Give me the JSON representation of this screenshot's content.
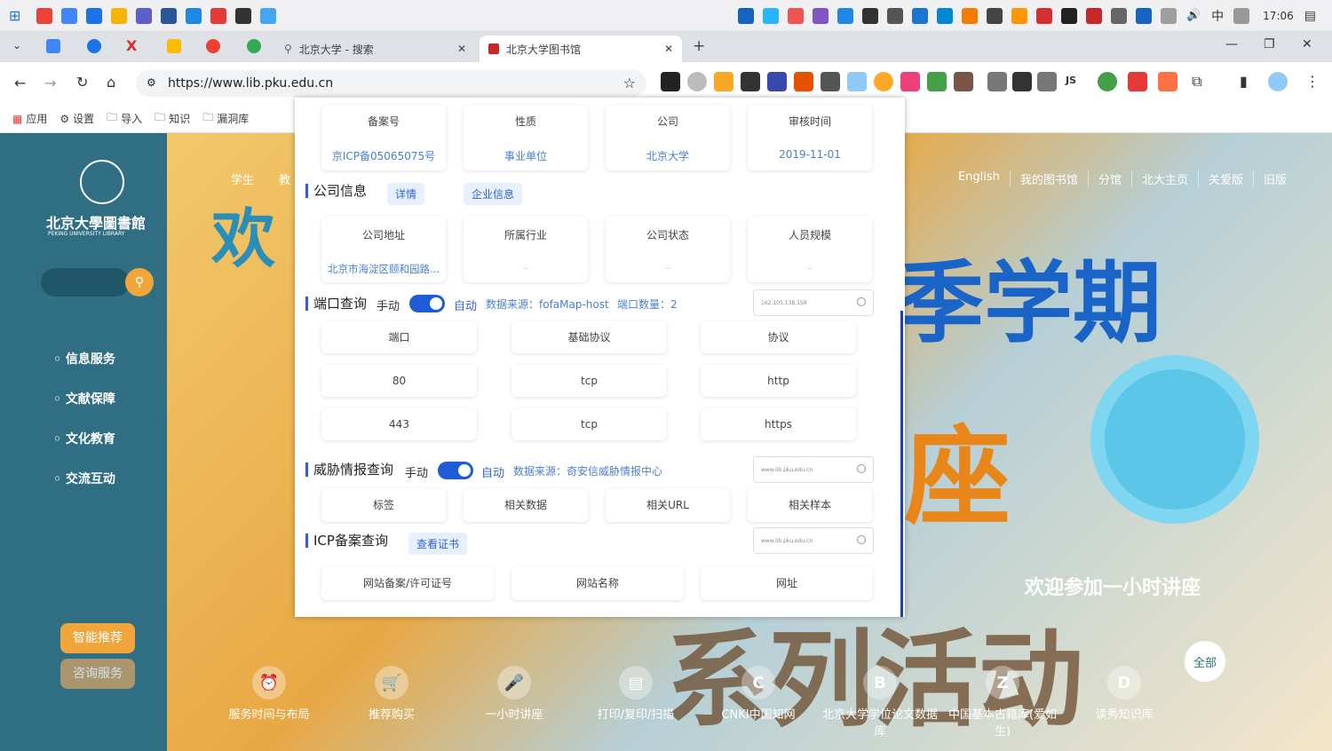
{
  "taskbar": {
    "clock": "17:06",
    "ime": "中"
  },
  "tabs": [
    {
      "label": "北京大学 - 搜索"
    },
    {
      "label": "北京大学图书馆"
    }
  ],
  "omnibox": {
    "url": "https://www.lib.pku.edu.cn"
  },
  "bookmarks": [
    "应用",
    "设置",
    "导入",
    "知识",
    "漏洞库"
  ],
  "site": {
    "logo_text": "北京大學圖書館",
    "logo_sub": "PEKING UNIVERSITY LIBRARY",
    "menu": [
      "信息服务",
      "文献保障",
      "文化教育",
      "交流互动"
    ],
    "nav": [
      "English",
      "我的图书馆",
      "分馆",
      "北大主页",
      "关爱版",
      "旧版"
    ],
    "nav_left": [
      "学生",
      "教"
    ],
    "hero_text": "欢迎参加一小时讲座",
    "hero_big": "季学期",
    "hero_big2": "系列活动",
    "hero_zuo": "座",
    "side_btns": [
      "智能推荐",
      "咨询服务"
    ],
    "all_btn": "全部",
    "shortcuts": [
      {
        "icon": "bell-icon",
        "label": "服务时间与布局"
      },
      {
        "icon": "cart-icon",
        "label": "推荐购买"
      },
      {
        "icon": "mic-icon",
        "label": "一小时讲座"
      },
      {
        "icon": "print-icon",
        "label": "打印/复印/扫描"
      },
      {
        "icon": "C",
        "label": "CNKI中国知网"
      },
      {
        "icon": "B",
        "label": "北京大学学位论文数据库"
      },
      {
        "icon": "Z",
        "label": "中国基本古籍库(爱如生)"
      },
      {
        "icon": "D",
        "label": "读秀知识库"
      }
    ]
  },
  "panel": {
    "icp_headers": [
      "备案号",
      "性质",
      "公司",
      "审核时间"
    ],
    "icp_values": [
      "京ICP备05065075号",
      "事业单位",
      "北京大学",
      "2019-11-01"
    ],
    "company_title": "公司信息",
    "company_tags": [
      "详情",
      "企业信息"
    ],
    "company_headers": [
      "公司地址",
      "所属行业",
      "公司状态",
      "人员规模"
    ],
    "company_values": [
      "北京市海淀区颐和园路...",
      "-",
      "-",
      "-"
    ],
    "port_title": "端口查询",
    "manual": "手动",
    "auto": "自动",
    "port_source": "数据来源：fofaMap-host",
    "port_count": "端口数量：2",
    "port_search": "162.105.138.158",
    "port_headers": [
      "端口",
      "基础协议",
      "协议"
    ],
    "port_rows": [
      [
        "80",
        "tcp",
        "http"
      ],
      [
        "443",
        "tcp",
        "https"
      ]
    ],
    "threat_title": "威胁情报查询",
    "threat_source": "数据来源：奇安信威胁情报中心",
    "threat_search": "www.lib.pku.edu.cn",
    "threat_headers": [
      "标签",
      "相关数据",
      "相关URL",
      "相关样本"
    ],
    "icp_title": "ICP备案查询",
    "icp_tag": "查看证书",
    "icp_search": "www.lib.pku.edu.cn",
    "icp2_headers": [
      "网站备案/许可证号",
      "网站名称",
      "网址"
    ]
  }
}
